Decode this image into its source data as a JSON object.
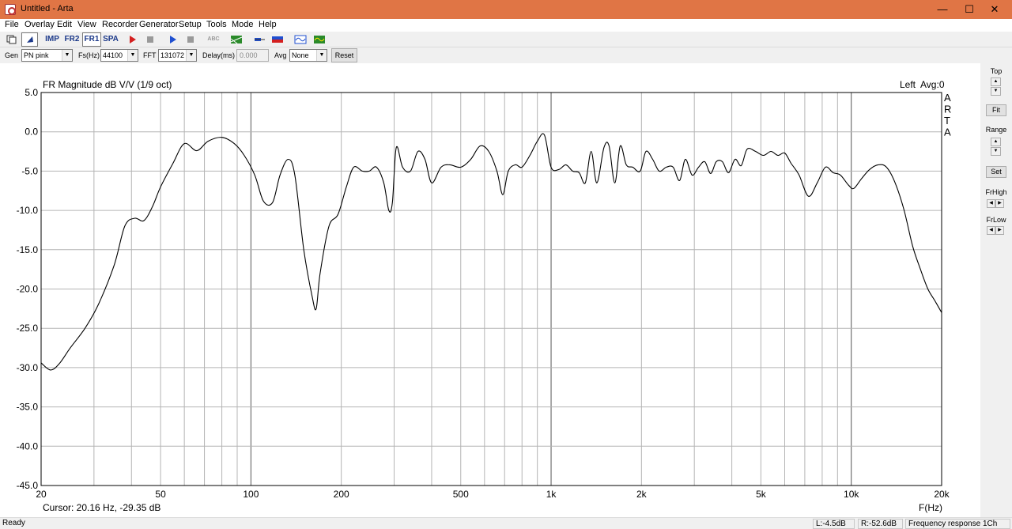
{
  "window": {
    "title": "Untitled - Arta",
    "minimize": "—",
    "maximize": "☐",
    "close": "✕"
  },
  "menu": [
    "File",
    "Overlay",
    "Edit",
    "View",
    "Recorder",
    "Generator",
    "Setup",
    "Tools",
    "Mode",
    "Help"
  ],
  "toolbar": {
    "imp": "IMP",
    "fr2": "FR2",
    "fr1": "FR1",
    "spa": "SPA",
    "abc": "ABC"
  },
  "params": {
    "gen_label": "Gen",
    "gen_value": "PN pink",
    "fs_label": "Fs(Hz)",
    "fs_value": "44100",
    "fft_label": "FFT",
    "fft_value": "131072",
    "delay_label": "Delay(ms)",
    "delay_value": "0.000",
    "avg_label": "Avg",
    "avg_value": "None",
    "reset_label": "Reset"
  },
  "side": {
    "top_label": "Top",
    "fit_label": "Fit",
    "range_label": "Range",
    "set_label": "Set",
    "frhigh_label": "FrHigh",
    "frlow_label": "FrLow"
  },
  "status": {
    "ready": "Ready",
    "left": "L:-4.5dB",
    "right": "R:-52.6dB",
    "mode": "Frequency response 1Ch"
  },
  "chart_data": {
    "type": "line",
    "title": "FR Magnitude dB V/V (1/9 oct)",
    "channel_info": "Left  Avg:0",
    "watermark": "ARTA",
    "xlabel": "F(Hz)",
    "cursor": "Cursor: 20.16 Hz, -29.35 dB",
    "x_scale": "log",
    "xlim": [
      20,
      20000
    ],
    "ylim": [
      -45,
      5
    ],
    "grid": true,
    "x_ticks": [
      20,
      50,
      100,
      200,
      500,
      1000,
      2000,
      5000,
      10000,
      20000
    ],
    "x_tick_labels": [
      "20",
      "50",
      "100",
      "200",
      "500",
      "1k",
      "2k",
      "5k",
      "10k",
      "20k"
    ],
    "y_ticks": [
      5,
      0,
      -5,
      -10,
      -15,
      -20,
      -25,
      -30,
      -35,
      -40,
      -45
    ],
    "y_tick_labels": [
      "5.0",
      "0.0",
      "-5.0",
      "-10.0",
      "-15.0",
      "-20.0",
      "-25.0",
      "-30.0",
      "-35.0",
      "-40.0",
      "-45.0"
    ],
    "series": [
      {
        "x": [
          20,
          21.5,
          23,
          25,
          28,
          31,
          35,
          38,
          41,
          44,
          47,
          50,
          55,
          60,
          66,
          72,
          80,
          88,
          95,
          103,
          110,
          118,
          125,
          133,
          140,
          150,
          160,
          165,
          170,
          182,
          195,
          208,
          220,
          235,
          248,
          262,
          277,
          288,
          296,
          305,
          320,
          340,
          360,
          380,
          400,
          430,
          460,
          500,
          540,
          580,
          620,
          660,
          690,
          720,
          760,
          800,
          850,
          900,
          950,
          1000,
          1060,
          1120,
          1180,
          1240,
          1300,
          1360,
          1420,
          1500,
          1560,
          1630,
          1700,
          1780,
          1870,
          1980,
          2070,
          2180,
          2290,
          2420,
          2550,
          2680,
          2800,
          2950,
          3100,
          3250,
          3400,
          3550,
          3720,
          3900,
          4100,
          4300,
          4500,
          4800,
          5100,
          5400,
          5700,
          6000,
          6300,
          6700,
          7200,
          7700,
          8200,
          8700,
          9200,
          9800,
          10200,
          10800,
          11500,
          12300,
          13100,
          14000,
          15000,
          16000,
          17000,
          18000,
          19000,
          20000
        ],
        "y": [
          -29.4,
          -30.3,
          -29.5,
          -27.5,
          -25,
          -22,
          -17,
          -12,
          -11,
          -11.3,
          -9.5,
          -7,
          -4,
          -1.5,
          -2.4,
          -1.2,
          -0.7,
          -1.5,
          -3,
          -5.5,
          -8.8,
          -9,
          -5.5,
          -3.5,
          -5.5,
          -15,
          -21,
          -22.5,
          -18,
          -12,
          -10.5,
          -7,
          -4.5,
          -5,
          -5,
          -4.5,
          -6.5,
          -10,
          -9,
          -2,
          -4.5,
          -5,
          -2.5,
          -3.5,
          -6.5,
          -4.5,
          -4.2,
          -4.5,
          -3.5,
          -1.8,
          -2.5,
          -5,
          -8,
          -5,
          -4.2,
          -4.5,
          -3,
          -1.2,
          -0.4,
          -4.5,
          -4.8,
          -4.2,
          -5,
          -5.2,
          -6.5,
          -2.5,
          -6.5,
          -2,
          -1.8,
          -6.5,
          -1.8,
          -4.2,
          -4.5,
          -5,
          -2.5,
          -3.5,
          -5,
          -4.5,
          -4.5,
          -6.2,
          -3.5,
          -5.5,
          -4.5,
          -3.8,
          -5.3,
          -3.8,
          -3.8,
          -5.2,
          -3.5,
          -4.3,
          -2.2,
          -2.5,
          -3,
          -2.5,
          -3,
          -2.7,
          -4,
          -5.5,
          -8.2,
          -6.5,
          -4.5,
          -5.2,
          -5.5,
          -6.8,
          -7.2,
          -6,
          -4.8,
          -4.2,
          -4.5,
          -6.5,
          -10,
          -14.5,
          -17.5,
          -20,
          -21.5,
          -23
        ]
      }
    ]
  }
}
